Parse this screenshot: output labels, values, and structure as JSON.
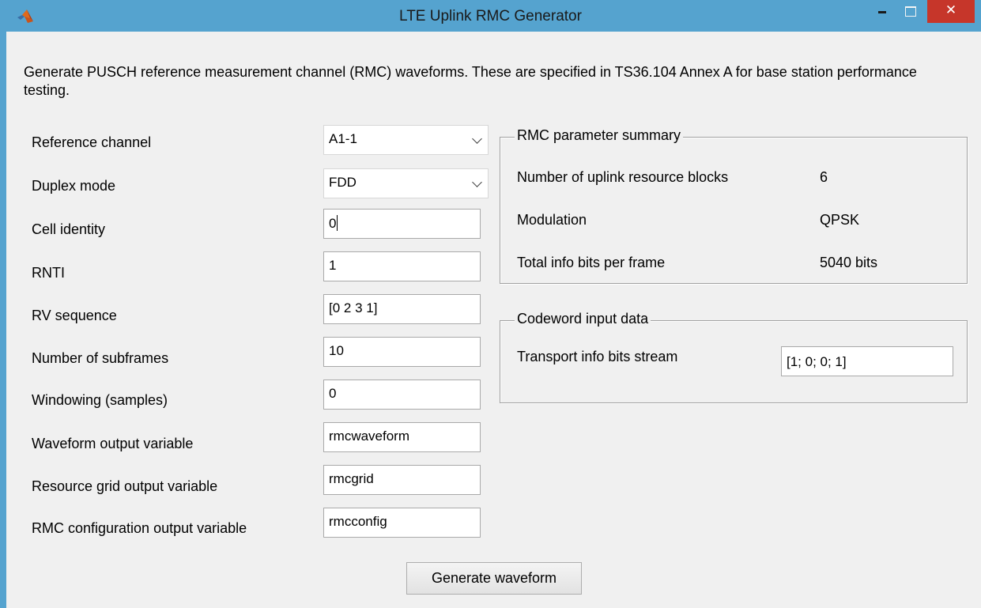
{
  "window": {
    "title": "LTE Uplink RMC Generator",
    "close_glyph": "✕",
    "icon": "matlab-logo-icon"
  },
  "description": "Generate PUSCH reference measurement channel (RMC) waveforms. These are specified in TS36.104 Annex A for base station performance testing.",
  "form": {
    "reference_channel": {
      "label": "Reference channel",
      "value": "A1-1"
    },
    "duplex_mode": {
      "label": "Duplex mode",
      "value": "FDD"
    },
    "cell_identity": {
      "label": "Cell identity",
      "value": "0"
    },
    "rnti": {
      "label": "RNTI",
      "value": "1"
    },
    "rv_sequence": {
      "label": "RV sequence",
      "value": "[0 2 3 1]"
    },
    "num_subframes": {
      "label": "Number of subframes",
      "value": "10"
    },
    "windowing": {
      "label": "Windowing (samples)",
      "value": "0"
    },
    "waveform_var": {
      "label": "Waveform output variable",
      "value": "rmcwaveform"
    },
    "grid_var": {
      "label": "Resource grid output variable",
      "value": "rmcgrid"
    },
    "config_var": {
      "label": "RMC configuration output variable",
      "value": "rmcconfig"
    }
  },
  "summary": {
    "title": "RMC parameter summary",
    "rows": [
      {
        "label": "Number of uplink resource blocks",
        "value": "6"
      },
      {
        "label": "Modulation",
        "value": "QPSK"
      },
      {
        "label": "Total info bits per frame",
        "value": "5040 bits"
      }
    ]
  },
  "codeword": {
    "title": "Codeword input data",
    "label": "Transport info bits stream",
    "value": "[1; 0; 0; 1]"
  },
  "generate_button": "Generate waveform",
  "colors": {
    "titlebar": "#55a3cf",
    "close": "#c6362a",
    "panel_bg": "#f0f0f0"
  }
}
